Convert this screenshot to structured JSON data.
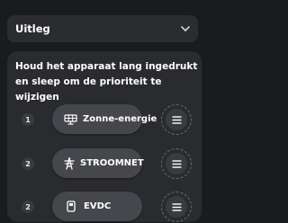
{
  "accordion": {
    "title": "Uitleg",
    "icon": "chevron-down-icon"
  },
  "instruction": "Houd het apparaat lang ingedrukt en sleep om de prioriteit te wijzigen",
  "devices": [
    {
      "rank": "1",
      "label": "Zonne-energie",
      "icon": "solar-panel-icon"
    },
    {
      "rank": "2",
      "label": "STROOMNET",
      "icon": "power-tower-icon"
    },
    {
      "rank": "2",
      "label": "EVDC",
      "icon": "ev-charger-icon"
    }
  ]
}
